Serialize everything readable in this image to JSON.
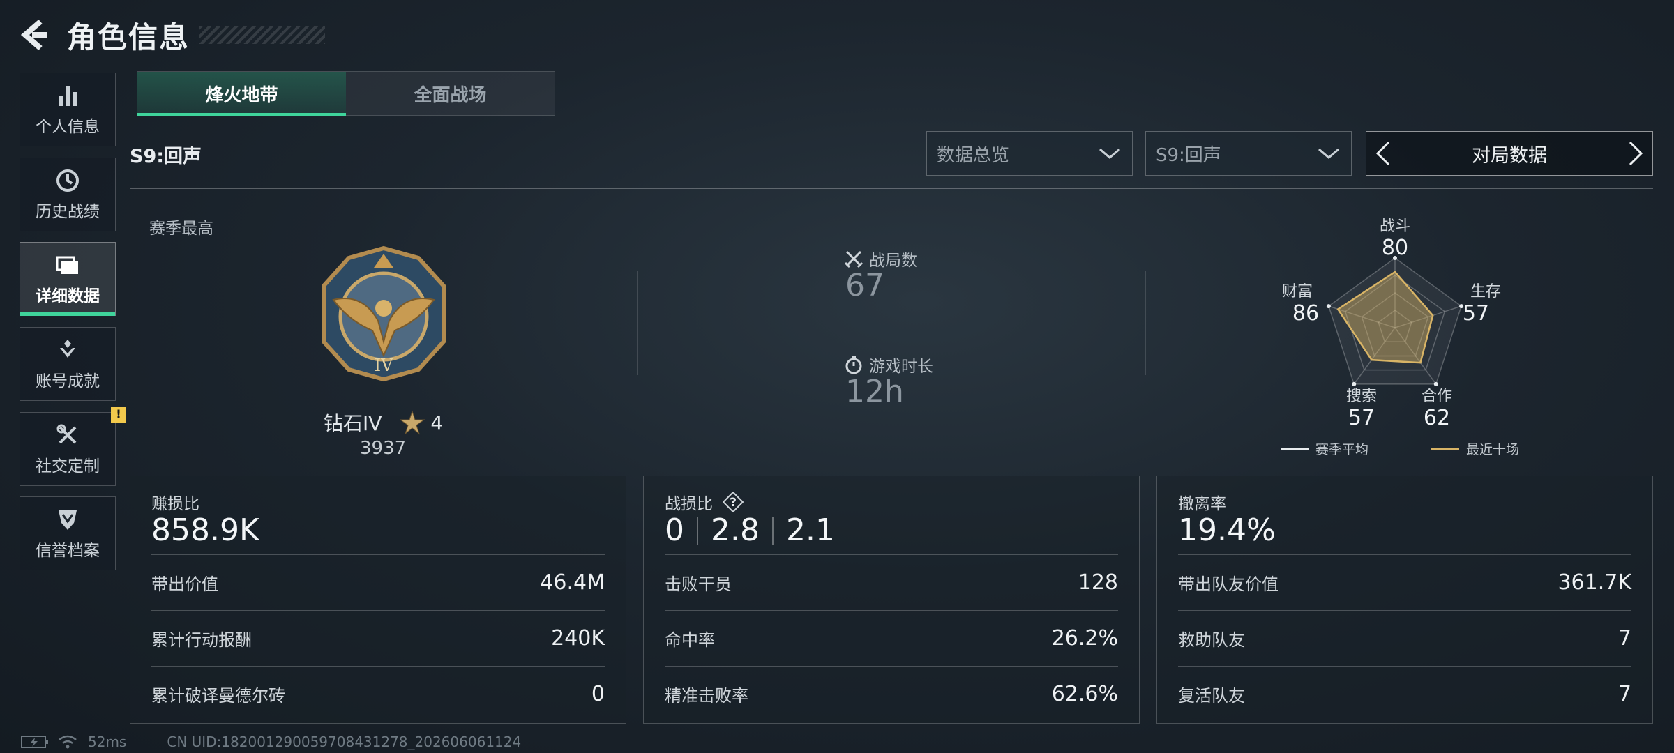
{
  "header": {
    "title": "角色信息"
  },
  "sidebar": {
    "items": [
      {
        "label": "个人信息"
      },
      {
        "label": "历史战绩"
      },
      {
        "label": "详细数据"
      },
      {
        "label": "账号成就"
      },
      {
        "label": "社交定制",
        "badge": "!"
      },
      {
        "label": "信誉档案"
      }
    ]
  },
  "tabs": [
    {
      "label": "烽火地带"
    },
    {
      "label": "全面战场"
    }
  ],
  "season_title": "S9:回声",
  "filters": {
    "overview": "数据总览",
    "season": "S9:回声"
  },
  "pager": {
    "label": "对局数据"
  },
  "rank": {
    "section_label": "赛季最高",
    "name": "钻石IV",
    "stars": "4",
    "score": "3937",
    "emblem_numeral": "IV"
  },
  "battles": {
    "label": "战局数",
    "value": "67"
  },
  "playtime": {
    "label": "游戏时长",
    "value": "12h"
  },
  "radar": {
    "axes": [
      {
        "label": "战斗",
        "value": 80
      },
      {
        "label": "生存",
        "value": 57
      },
      {
        "label": "合作",
        "value": 62
      },
      {
        "label": "搜索",
        "value": 57
      },
      {
        "label": "财富",
        "value": 86
      }
    ],
    "legend": {
      "season_avg": "赛季平均",
      "recent": "最近十场"
    },
    "colors": {
      "season_avg": "#e8ecef",
      "recent": "#d8b466"
    }
  },
  "cards": {
    "profit": {
      "label": "赚损比",
      "value": "858.9K",
      "rows": [
        {
          "k": "带出价值",
          "v": "46.4M"
        },
        {
          "k": "累计行动报酬",
          "v": "240K"
        },
        {
          "k": "累计破译曼德尔砖",
          "v": "0"
        }
      ]
    },
    "combat": {
      "label": "战损比",
      "help": "?",
      "v1": "0",
      "v2": "2.8",
      "v3": "2.1",
      "rows": [
        {
          "k": "击败干员",
          "v": "128"
        },
        {
          "k": "命中率",
          "v": "26.2%"
        },
        {
          "k": "精准击败率",
          "v": "62.6%"
        }
      ]
    },
    "extract": {
      "label": "撤离率",
      "value": "19.4%",
      "rows": [
        {
          "k": "带出队友价值",
          "v": "361.7K"
        },
        {
          "k": "救助队友",
          "v": "7"
        },
        {
          "k": "复活队友",
          "v": "7"
        }
      ]
    }
  },
  "footer": {
    "ping": "52ms",
    "uid": "CN UID:182001290059708431278_202606061124"
  },
  "colors": {
    "accent": "#3fd49b",
    "badge": "#f2c94c"
  }
}
